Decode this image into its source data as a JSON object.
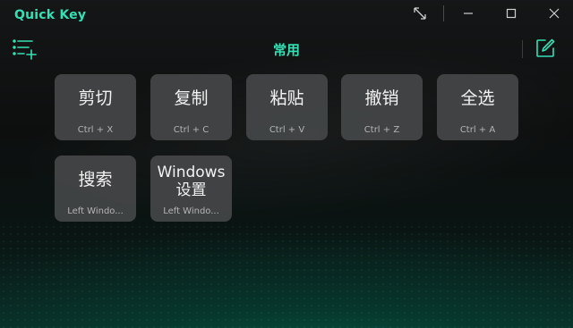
{
  "window": {
    "title": "Quick Key",
    "accent_color": "#35e0b4",
    "controls": [
      "expand-icon",
      "minimize-icon",
      "maximize-icon",
      "close-icon"
    ]
  },
  "header": {
    "title": "常用",
    "menu_icon": "list-add-icon",
    "edit_icon": "edit-icon"
  },
  "keys": [
    {
      "name": "剪切",
      "shortcut": "Ctrl + X"
    },
    {
      "name": "复制",
      "shortcut": "Ctrl + C"
    },
    {
      "name": "粘贴",
      "shortcut": "Ctrl + V"
    },
    {
      "name": "撤销",
      "shortcut": "Ctrl + Z"
    },
    {
      "name": "全选",
      "shortcut": "Ctrl + A"
    },
    {
      "name": "搜索",
      "shortcut": "Left Windo..."
    },
    {
      "name_line1": "Windows",
      "name_line2": "设置",
      "shortcut": "Left Windo..."
    }
  ]
}
